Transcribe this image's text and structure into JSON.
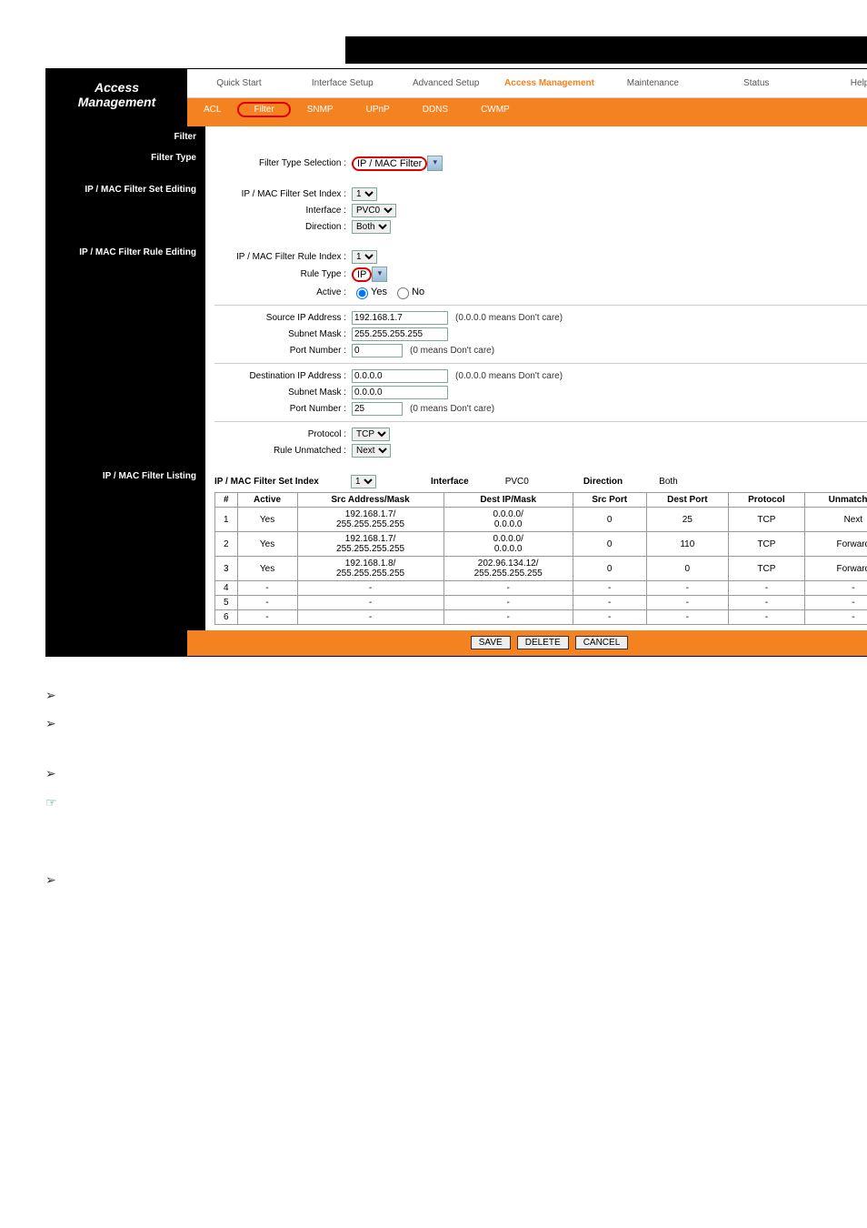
{
  "header": {
    "title_line1": "Access",
    "title_line2": "Management",
    "tabs": [
      "Quick Start",
      "Interface Setup",
      "Advanced Setup",
      "Access Management",
      "Maintenance",
      "Status",
      "Help"
    ],
    "active_tab": 3,
    "subtabs": [
      "ACL",
      "Filter",
      "SNMP",
      "UPnP",
      "DDNS",
      "CWMP"
    ],
    "active_subtab": 1
  },
  "sections": {
    "filter": "Filter",
    "filter_type": "Filter Type",
    "set_editing": "IP / MAC Filter Set Editing",
    "rule_editing": "IP / MAC Filter Rule Editing",
    "listing": "IP / MAC Filter Listing"
  },
  "filter_type": {
    "label": "Filter Type Selection :",
    "value": "IP / MAC Filter"
  },
  "set_editing": {
    "set_index_label": "IP / MAC Filter Set Index :",
    "set_index": "1",
    "interface_label": "Interface :",
    "interface": "PVC0",
    "direction_label": "Direction :",
    "direction": "Both"
  },
  "rule_editing": {
    "rule_index_label": "IP / MAC Filter Rule Index :",
    "rule_index": "1",
    "rule_type_label": "Rule Type :",
    "rule_type": "IP",
    "active_label": "Active :",
    "active_yes": "Yes",
    "active_no": "No",
    "src_ip_label": "Source IP Address :",
    "src_ip": "192.168.1.7",
    "src_ip_hint": "(0.0.0.0 means Don't care)",
    "src_mask_label": "Subnet Mask :",
    "src_mask": "255.255.255.255",
    "src_port_label": "Port Number :",
    "src_port": "0",
    "src_port_hint": "(0 means Don't care)",
    "dst_ip_label": "Destination IP Address :",
    "dst_ip": "0.0.0.0",
    "dst_ip_hint": "(0.0.0.0 means Don't care)",
    "dst_mask_label": "Subnet Mask :",
    "dst_mask": "0.0.0.0",
    "dst_port_label": "Port Number :",
    "dst_port": "25",
    "dst_port_hint": "(0 means Don't care)",
    "protocol_label": "Protocol :",
    "protocol": "TCP",
    "unmatched_label": "Rule Unmatched :",
    "unmatched": "Next"
  },
  "listing": {
    "set_index_label": "IP / MAC Filter Set Index",
    "set_index": "1",
    "interface_label": "Interface",
    "interface_value": "PVC0",
    "direction_label": "Direction",
    "direction_value": "Both",
    "headers": [
      "#",
      "Active",
      "Src Address/Mask",
      "Dest IP/Mask",
      "Src Port",
      "Dest Port",
      "Protocol",
      "Unmatched"
    ],
    "rows": [
      {
        "n": "1",
        "active": "Yes",
        "src": "192.168.1.7/\n255.255.255.255",
        "dst": "0.0.0.0/\n0.0.0.0",
        "sport": "0",
        "dport": "25",
        "proto": "TCP",
        "un": "Next"
      },
      {
        "n": "2",
        "active": "Yes",
        "src": "192.168.1.7/\n255.255.255.255",
        "dst": "0.0.0.0/\n0.0.0.0",
        "sport": "0",
        "dport": "110",
        "proto": "TCP",
        "un": "Forward"
      },
      {
        "n": "3",
        "active": "Yes",
        "src": "192.168.1.8/\n255.255.255.255",
        "dst": "202.96.134.12/\n255.255.255.255",
        "sport": "0",
        "dport": "0",
        "proto": "TCP",
        "un": "Forward"
      },
      {
        "n": "4",
        "active": "-",
        "src": "-",
        "dst": "-",
        "sport": "-",
        "dport": "-",
        "proto": "-",
        "un": "-"
      },
      {
        "n": "5",
        "active": "-",
        "src": "-",
        "dst": "-",
        "sport": "-",
        "dport": "-",
        "proto": "-",
        "un": "-"
      },
      {
        "n": "6",
        "active": "-",
        "src": "-",
        "dst": "-",
        "sport": "-",
        "dport": "-",
        "proto": "-",
        "un": "-"
      }
    ]
  },
  "buttons": {
    "save": "SAVE",
    "delete": "DELETE",
    "cancel": "CANCEL"
  }
}
